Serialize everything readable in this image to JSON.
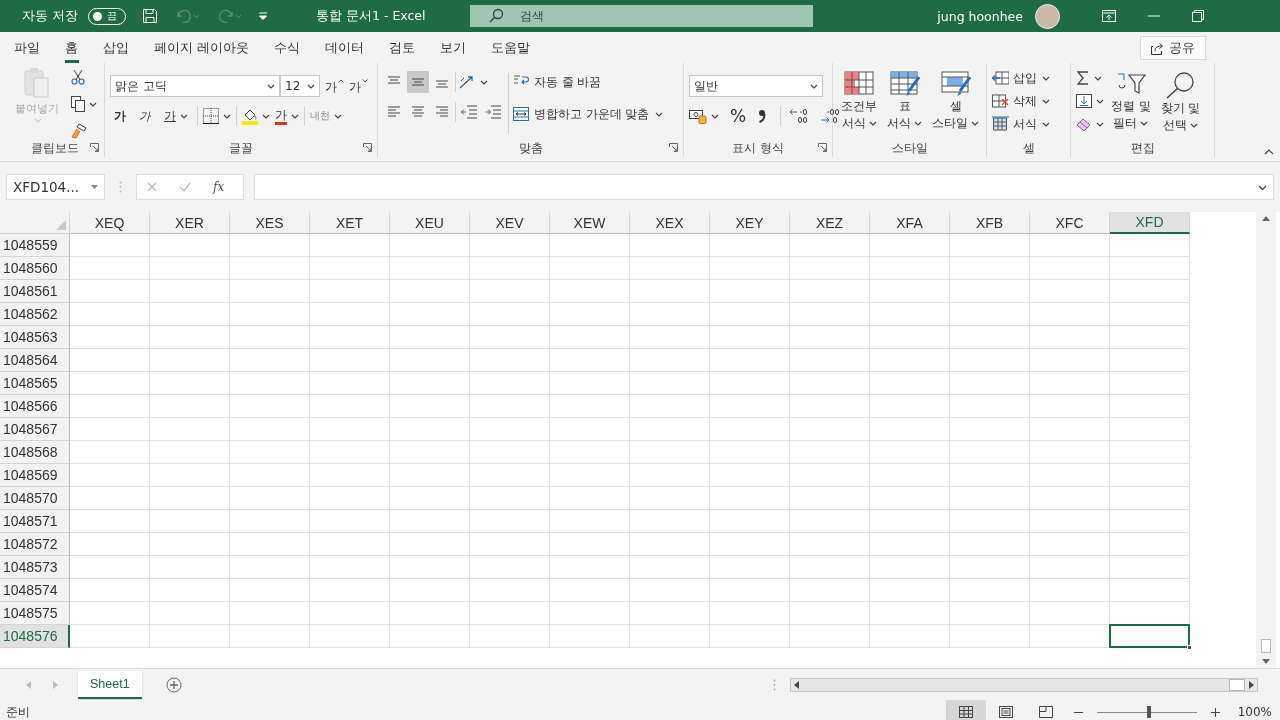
{
  "title_bar": {
    "autosave": {
      "label": "자동 저장",
      "toggle_text": "끔",
      "on": false
    },
    "quick_access": [
      {
        "kind": "save",
        "disabled": false
      },
      {
        "kind": "undo",
        "disabled": true
      },
      {
        "kind": "redo",
        "disabled": true
      },
      {
        "kind": "customize",
        "disabled": false
      }
    ],
    "doc_title": "통합 문서1  -  Excel",
    "search": {
      "placeholder": "검색"
    },
    "user_name": "jung hoonhee"
  },
  "menu_tabs": [
    {
      "label": "파일",
      "selected": false
    },
    {
      "label": "홈",
      "selected": true
    },
    {
      "label": "삽입",
      "selected": false
    },
    {
      "label": "페이지 레이아웃",
      "selected": false
    },
    {
      "label": "수식",
      "selected": false
    },
    {
      "label": "데이터",
      "selected": false
    },
    {
      "label": "검토",
      "selected": false
    },
    {
      "label": "보기",
      "selected": false
    },
    {
      "label": "도움말",
      "selected": false
    }
  ],
  "share_button": "공유",
  "ribbon": {
    "groups": [
      {
        "kind": "clipboard",
        "label": "클립보드",
        "launcher": true,
        "paste": {
          "label": "붙여넣기",
          "disabled": true
        }
      },
      {
        "kind": "font",
        "label": "글꼴",
        "launcher": true,
        "font_name": "맑은 고딕",
        "font_size": "12",
        "size_buttons": [
          "가",
          "가"
        ],
        "style_buttons": [
          {
            "kind": "bold",
            "label": "가"
          },
          {
            "kind": "italic",
            "label": "가"
          },
          {
            "kind": "underline",
            "label": "가"
          }
        ],
        "font_color_button": "가",
        "phonetic_button": "내천"
      },
      {
        "kind": "alignment",
        "label": "맞춤",
        "launcher": true,
        "vertical_align": [
          {
            "selected": false
          },
          {
            "selected": true
          },
          {
            "selected": false
          }
        ],
        "horizontal_align": [
          {
            "selected": false
          },
          {
            "selected": false
          },
          {
            "selected": false
          }
        ],
        "wrap_text": "자동 줄 바꿈",
        "merge": "병합하고 가운데 맞춤"
      },
      {
        "kind": "number",
        "label": "표시 형식",
        "launcher": true,
        "format": "일반",
        "percent": "%"
      },
      {
        "kind": "styles",
        "label": "스타일",
        "launcher": false,
        "buttons": [
          {
            "kind": "conditional",
            "lines": [
              "조건부",
              "서식"
            ]
          },
          {
            "kind": "table",
            "lines": [
              "표",
              "서식"
            ]
          },
          {
            "kind": "cell",
            "lines": [
              "셀",
              "스타일"
            ]
          }
        ]
      },
      {
        "kind": "cells",
        "label": "셀",
        "launcher": false,
        "buttons": [
          {
            "kind": "insert",
            "label": "삽입"
          },
          {
            "kind": "delete",
            "label": "삭제"
          },
          {
            "kind": "format",
            "label": "서식"
          }
        ]
      },
      {
        "kind": "editing",
        "label": "편집",
        "launcher": false,
        "buttons": [
          {
            "kind": "sort",
            "lines": [
              "정렬 및",
              "필터"
            ]
          },
          {
            "kind": "find",
            "lines": [
              "찾기 및",
              "선택"
            ]
          }
        ]
      }
    ]
  },
  "formula_bar": {
    "name_box": "XFD104...",
    "function_label": "fx"
  },
  "grid": {
    "columns": [
      {
        "label": "XEQ",
        "selected": false
      },
      {
        "label": "XER",
        "selected": false
      },
      {
        "label": "XES",
        "selected": false
      },
      {
        "label": "XET",
        "selected": false
      },
      {
        "label": "XEU",
        "selected": false
      },
      {
        "label": "XEV",
        "selected": false
      },
      {
        "label": "XEW",
        "selected": false
      },
      {
        "label": "XEX",
        "selected": false
      },
      {
        "label": "XEY",
        "selected": false
      },
      {
        "label": "XEZ",
        "selected": false
      },
      {
        "label": "XFA",
        "selected": false
      },
      {
        "label": "XFB",
        "selected": false
      },
      {
        "label": "XFC",
        "selected": false
      },
      {
        "label": "XFD",
        "selected": true
      }
    ],
    "rows": [
      {
        "label": "1048559",
        "selected": false
      },
      {
        "label": "1048560",
        "selected": false
      },
      {
        "label": "1048561",
        "selected": false
      },
      {
        "label": "1048562",
        "selected": false
      },
      {
        "label": "1048563",
        "selected": false
      },
      {
        "label": "1048564",
        "selected": false
      },
      {
        "label": "1048565",
        "selected": false
      },
      {
        "label": "1048566",
        "selected": false
      },
      {
        "label": "1048567",
        "selected": false
      },
      {
        "label": "1048568",
        "selected": false
      },
      {
        "label": "1048569",
        "selected": false
      },
      {
        "label": "1048570",
        "selected": false
      },
      {
        "label": "1048571",
        "selected": false
      },
      {
        "label": "1048572",
        "selected": false
      },
      {
        "label": "1048573",
        "selected": false
      },
      {
        "label": "1048574",
        "selected": false
      },
      {
        "label": "1048575",
        "selected": false
      },
      {
        "label": "1048576",
        "selected": true
      }
    ]
  },
  "sheet_tabs": [
    {
      "label": "Sheet1",
      "selected": true
    }
  ],
  "status_bar": {
    "status": "준비",
    "views": [
      {
        "kind": "normal",
        "selected": true
      },
      {
        "kind": "page_layout",
        "selected": false
      },
      {
        "kind": "page_break",
        "selected": false
      }
    ],
    "zoom": {
      "level": 0.5,
      "reading": "100%"
    }
  }
}
